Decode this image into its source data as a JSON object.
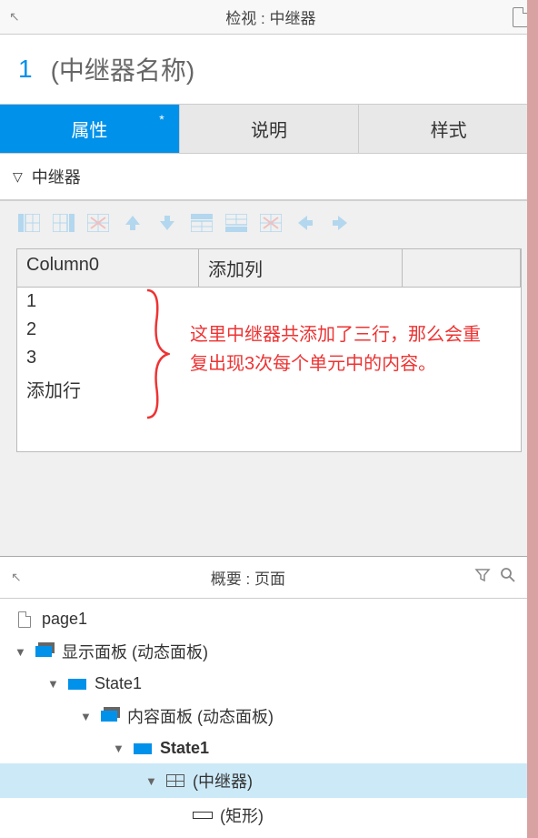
{
  "inspector": {
    "header_title": "检视 : 中继器",
    "widget_index": "1",
    "widget_name": "(中继器名称)"
  },
  "tabs": {
    "properties": "属性",
    "notes": "说明",
    "style": "样式",
    "dirty_marker": "*"
  },
  "section": {
    "title": "中继器"
  },
  "table": {
    "col0": "Column0",
    "add_col": "添加列",
    "rows": [
      "1",
      "2",
      "3"
    ],
    "add_row": "添加行"
  },
  "annotation": {
    "text": "这里中继器共添加了三行，那么会重复出现3次每个单元中的内容。"
  },
  "outline": {
    "header_title": "概要 : 页面",
    "items": {
      "page": "page1",
      "display_panel": "显示面板 (动态面板)",
      "state1a": "State1",
      "content_panel": "内容面板 (动态面板)",
      "state1b": "State1",
      "repeater": "(中继器)",
      "rect": "(矩形)"
    }
  }
}
